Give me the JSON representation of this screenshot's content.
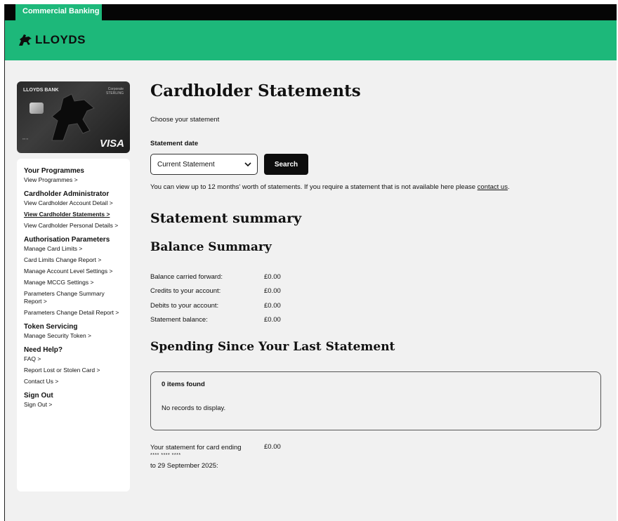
{
  "topbar": {
    "tab": "Commercial Banking"
  },
  "brand": {
    "name": "LLOYDS"
  },
  "card": {
    "bank": "LLOYDS BANK",
    "type_line1": "Corporate",
    "type_line2": "STERLING",
    "network": "VISA"
  },
  "sidebar": {
    "groups": [
      {
        "heading": "Your Programmes",
        "links": [
          "View Programmes >"
        ]
      },
      {
        "heading": "Cardholder Administrator",
        "links": [
          "View Cardholder Account Detail >",
          "View Cardholder Statements >",
          "View Cardholder Personal Details >"
        ]
      },
      {
        "heading": "Authorisation Parameters",
        "links": [
          "Manage Card Limits >",
          "Card Limits Change Report >",
          "Manage Account Level Settings >",
          "Manage MCCG Settings >",
          "Parameters Change Summary Report >",
          "Parameters Change Detail Report >"
        ]
      },
      {
        "heading": "Token Servicing",
        "links": [
          "Manage Security Token >"
        ]
      },
      {
        "heading": "Need Help?",
        "links": [
          "FAQ >",
          "Report Lost or Stolen Card >",
          "Contact Us >"
        ]
      },
      {
        "heading": "Sign Out",
        "links": [
          "Sign Out >"
        ]
      }
    ]
  },
  "main": {
    "title": "Cardholder Statements",
    "subtitle": "Choose your statement",
    "date_label": "Statement date",
    "date_value": "Current Statement",
    "search_label": "Search",
    "info_text": "You can view up to 12 months' worth of statements. If you require a statement that is not available here please ",
    "info_link": "contact us",
    "info_end": ".",
    "summary_title": "Statement summary",
    "balance_title": "Balance Summary",
    "balance_rows": [
      {
        "label": "Balance carried forward:",
        "value": "£0.00"
      },
      {
        "label": "Credits to your account:",
        "value": "£0.00"
      },
      {
        "label": "Debits to your account:",
        "value": "£0.00"
      },
      {
        "label": "Statement balance:",
        "value": "£0.00"
      }
    ],
    "spending_title": "Spending Since Your Last Statement",
    "results_count": "0 items found",
    "results_empty": "No records to display.",
    "stmt_label": "Your statement for card ending",
    "stmt_mask": "**** **** ****",
    "stmt_period": "to 29 September 2025:",
    "stmt_value": "£0.00"
  }
}
